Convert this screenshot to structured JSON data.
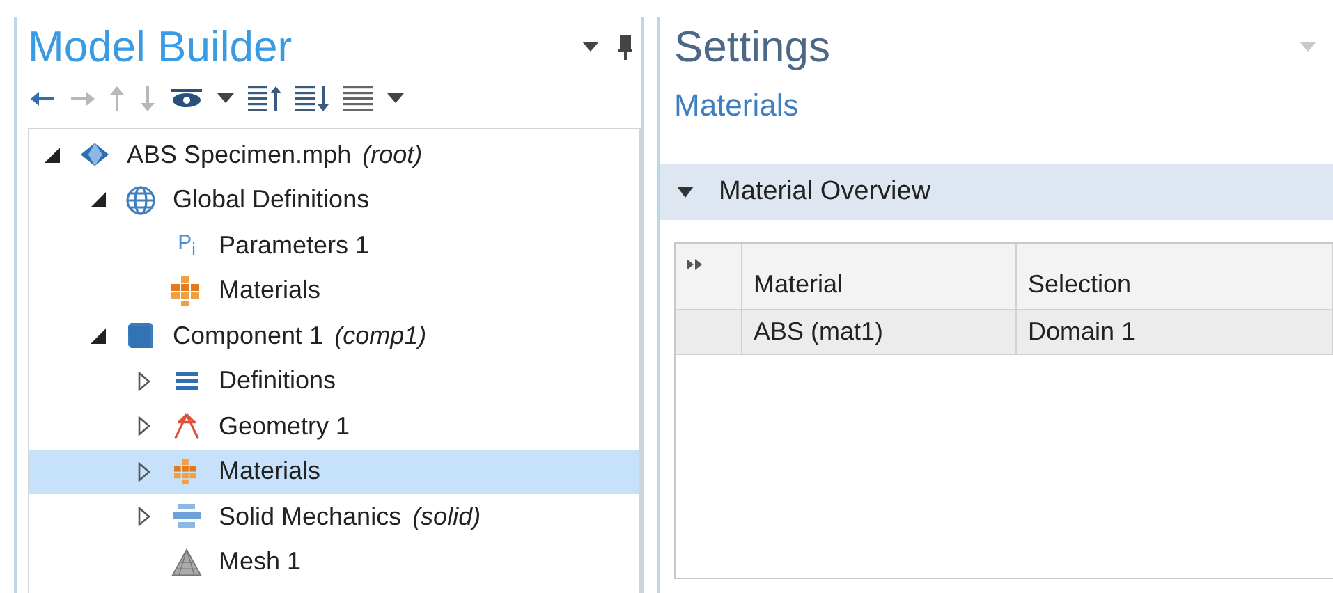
{
  "model_builder": {
    "title": "Model Builder",
    "toolbar": [
      {
        "kind": "back",
        "disabled": false
      },
      {
        "kind": "forward",
        "disabled": true
      },
      {
        "kind": "up",
        "disabled": true
      },
      {
        "kind": "down",
        "disabled": true
      },
      {
        "kind": "show",
        "disabled": false
      },
      {
        "kind": "collapse",
        "disabled": false
      },
      {
        "kind": "expand",
        "disabled": false
      },
      {
        "kind": "list",
        "disabled": false
      }
    ],
    "tree": [
      {
        "label": "ABS Specimen.mph",
        "note": "(root)",
        "kind": "model",
        "expanded": true,
        "selected": false,
        "children": [
          {
            "label": "Global Definitions",
            "kind": "globe",
            "expanded": true,
            "selected": false,
            "children": [
              {
                "label": "Parameters 1",
                "kind": "parameters",
                "glyph": "P$_{i}$",
                "selected": false
              },
              {
                "label": "Materials",
                "kind": "materials",
                "selected": false
              }
            ]
          },
          {
            "label": "Component 1",
            "note": "(comp1)",
            "kind": "component",
            "expanded": true,
            "selected": false,
            "children": [
              {
                "label": "Definitions",
                "kind": "definitions",
                "expanded": false,
                "selected": false
              },
              {
                "label": "Geometry 1",
                "kind": "geometry",
                "expanded": false,
                "selected": false
              },
              {
                "label": "Materials",
                "kind": "materials-small",
                "expanded": false,
                "selected": true
              },
              {
                "label": "Solid Mechanics",
                "note": "(solid)",
                "kind": "physics",
                "expanded": false,
                "selected": false
              },
              {
                "label": "Mesh 1",
                "kind": "mesh",
                "selected": false
              }
            ]
          }
        ]
      }
    ]
  },
  "settings": {
    "title": "Settings",
    "subtitle": "Materials",
    "section": {
      "title": "Material Overview",
      "expanded": true
    },
    "table": {
      "columns": [
        "Material",
        "Selection"
      ],
      "rows": [
        [
          "ABS (mat1)",
          "Domain 1"
        ]
      ]
    }
  }
}
